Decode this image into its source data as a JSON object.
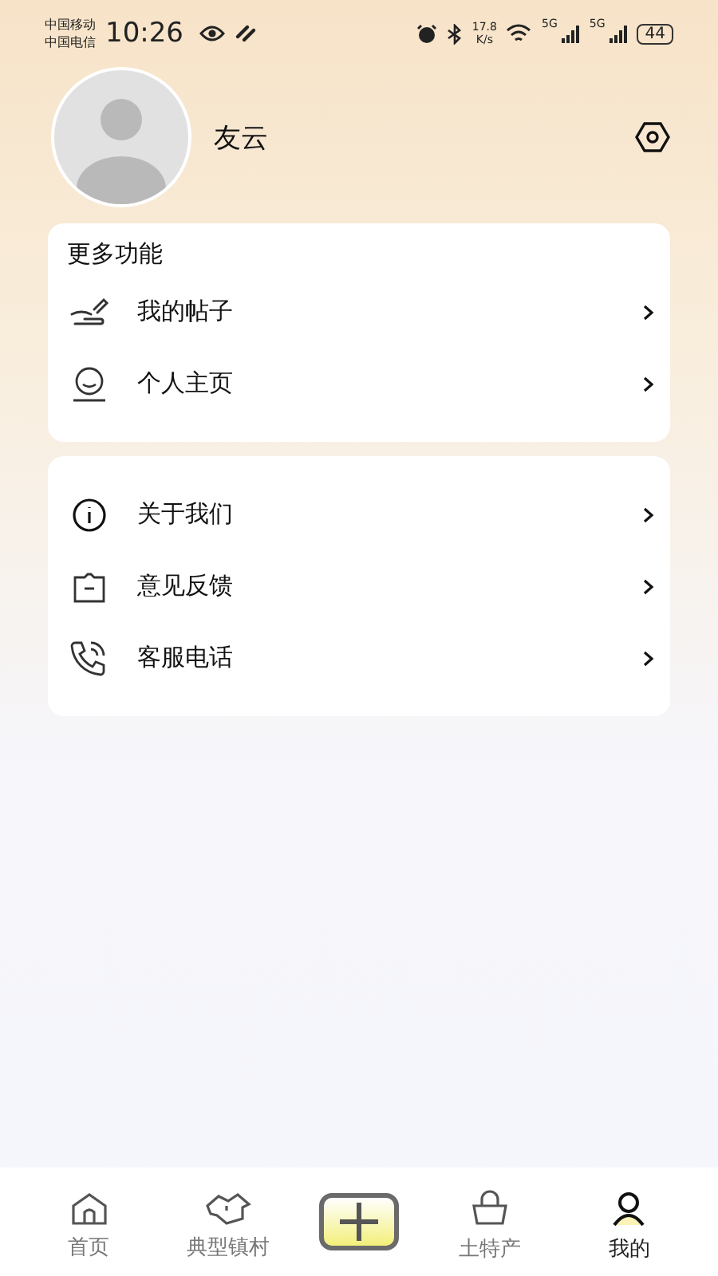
{
  "status_bar": {
    "carriers": [
      "中国移动",
      "中国电信"
    ],
    "time": "10:26",
    "speed": "17.8",
    "speed_unit": "K/s",
    "networks": [
      "5G",
      "5G"
    ],
    "battery": "44"
  },
  "profile": {
    "name": "友云"
  },
  "cards": [
    {
      "title": "更多功能",
      "items": [
        {
          "kind": "post",
          "label": "我的帖子"
        },
        {
          "kind": "face",
          "label": "个人主页"
        }
      ]
    },
    {
      "items": [
        {
          "kind": "info",
          "label": "关于我们"
        },
        {
          "kind": "feedback",
          "label": "意见反馈"
        },
        {
          "kind": "phone",
          "label": "客服电话"
        }
      ]
    }
  ],
  "tabs": [
    {
      "kind": "home",
      "label": "首页",
      "selected": false
    },
    {
      "kind": "village",
      "label": "典型镇村",
      "selected": false
    },
    {
      "kind": "add",
      "selected": false
    },
    {
      "kind": "bag",
      "label": "土特产",
      "selected": false
    },
    {
      "kind": "user",
      "label": "我的",
      "selected": true
    }
  ]
}
